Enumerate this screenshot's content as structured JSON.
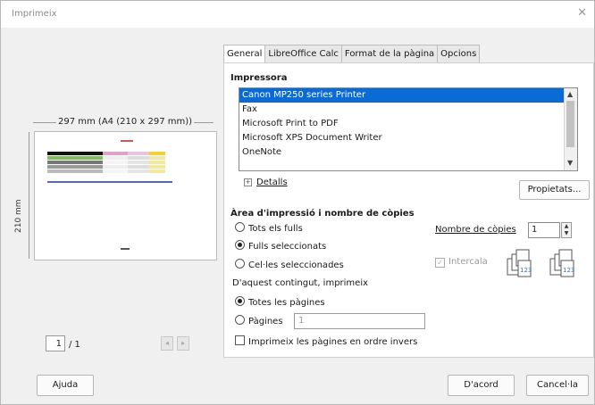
{
  "window": {
    "title": "Imprimeix",
    "close_glyph": "✕"
  },
  "preview": {
    "paper_size_label": "297 mm (A4 (210 x 297 mm))",
    "side_label": "210 mm",
    "page_current": "1",
    "page_total": "/ 1",
    "prev_glyph": "◂",
    "next_glyph": "▸"
  },
  "tabs": [
    {
      "label": "General",
      "active": true
    },
    {
      "label": "LibreOffice Calc",
      "active": false
    },
    {
      "label": "Format de la pàgina",
      "active": false
    },
    {
      "label": "Opcions",
      "active": false
    }
  ],
  "printer": {
    "section_title": "Impressora",
    "items": [
      {
        "label": "Canon MP250 series Printer",
        "selected": true
      },
      {
        "label": "Fax",
        "selected": false
      },
      {
        "label": "Microsoft Print to PDF",
        "selected": false
      },
      {
        "label": "Microsoft XPS Document Writer",
        "selected": false
      },
      {
        "label": "OneNote",
        "selected": false
      }
    ],
    "details_label": "Detalls",
    "properties_button": "Propietats..."
  },
  "area": {
    "section_title": "Àrea d'impressió i nombre de còpies",
    "options": [
      {
        "label": "Tots els fulls",
        "checked": false
      },
      {
        "label": "Fulls seleccionats",
        "checked": true
      },
      {
        "label": "Cel·les seleccionades",
        "checked": false
      }
    ],
    "copies_label": "Nombre de còpies",
    "copies_value": "1",
    "collate_label": "Intercala",
    "collate_checked": true
  },
  "content": {
    "title": "D'aquest contingut, imprimeix",
    "all_pages_label": "Totes les pàgines",
    "pages_label": "Pàgines",
    "pages_value": "1",
    "reverse_label": "Imprimeix les pàgines en ordre invers"
  },
  "buttons": {
    "help": "Ajuda",
    "ok": "D'acord",
    "cancel": "Cancel·la"
  },
  "colors": {
    "selection": "#0a6ad6",
    "dialog_bg": "#f0f0f0"
  }
}
